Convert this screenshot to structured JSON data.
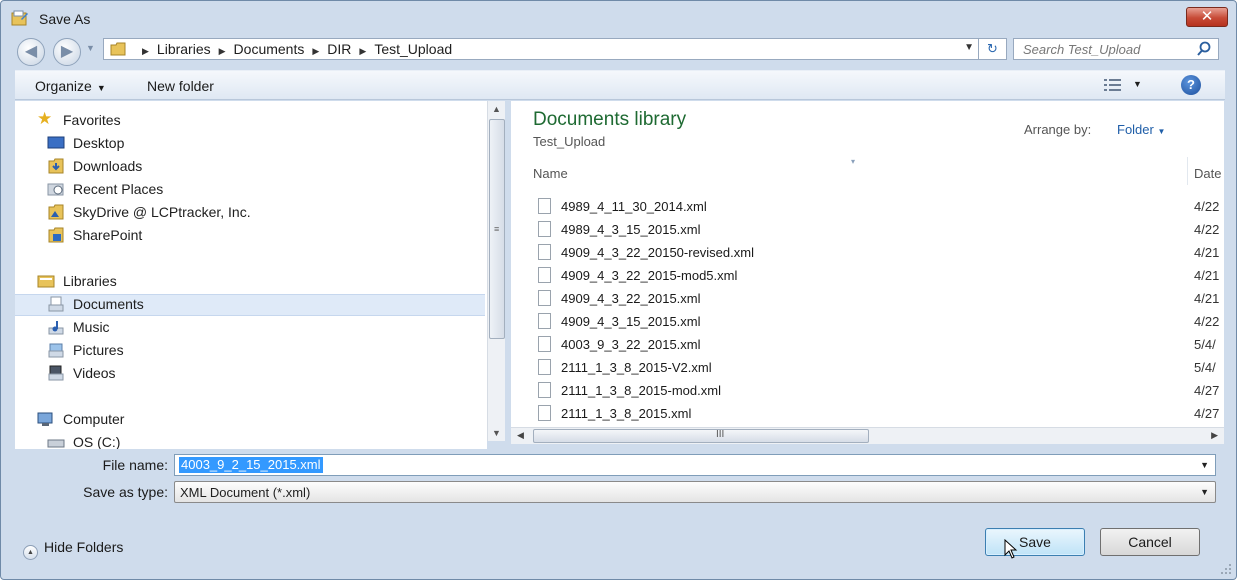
{
  "window": {
    "title": "Save As",
    "close_label": "✕"
  },
  "address": {
    "breadcrumbs": [
      "Libraries",
      "Documents",
      "DIR",
      "Test_Upload"
    ]
  },
  "search": {
    "placeholder": "Search Test_Upload"
  },
  "toolbar": {
    "organize_label": "Organize",
    "new_folder_label": "New folder",
    "help_label": "?"
  },
  "nav": {
    "favorites_header": "Favorites",
    "favorites": [
      "Desktop",
      "Downloads",
      "Recent Places",
      "SkyDrive @ LCPtracker, Inc.",
      "SharePoint"
    ],
    "libraries_header": "Libraries",
    "libraries": [
      "Documents",
      "Music",
      "Pictures",
      "Videos"
    ],
    "computer_header": "Computer",
    "computer_items": [
      "OS (C:)"
    ],
    "selected": "Documents"
  },
  "file_pane": {
    "library_title": "Documents library",
    "library_subtitle": "Test_Upload",
    "arrange_label": "Arrange by:",
    "arrange_value": "Folder",
    "columns": {
      "name": "Name",
      "date": "Date"
    },
    "files": [
      {
        "name": "4989_4_11_30_2014.xml",
        "date": "4/22"
      },
      {
        "name": "4989_4_3_15_2015.xml",
        "date": "4/22"
      },
      {
        "name": "4909_4_3_22_20150-revised.xml",
        "date": "4/21"
      },
      {
        "name": "4909_4_3_22_2015-mod5.xml",
        "date": "4/21"
      },
      {
        "name": "4909_4_3_22_2015.xml",
        "date": "4/21"
      },
      {
        "name": "4909_4_3_15_2015.xml",
        "date": "4/22"
      },
      {
        "name": "4003_9_3_22_2015.xml",
        "date": "5/4/"
      },
      {
        "name": "2111_1_3_8_2015-V2.xml",
        "date": "5/4/"
      },
      {
        "name": "2111_1_3_8_2015-mod.xml",
        "date": "4/27"
      },
      {
        "name": "2111_1_3_8_2015.xml",
        "date": "4/27"
      }
    ]
  },
  "form": {
    "file_name_label": "File name:",
    "file_name_value": "4003_9_2_15_2015.xml",
    "save_type_label": "Save as type:",
    "save_type_value": "XML Document (*.xml)"
  },
  "footer": {
    "hide_folders_label": "Hide Folders",
    "save_label": "Save",
    "cancel_label": "Cancel"
  },
  "colors": {
    "library_title": "#1e6a32",
    "link_blue": "#1f5ea8",
    "selection": "#3399ff"
  }
}
